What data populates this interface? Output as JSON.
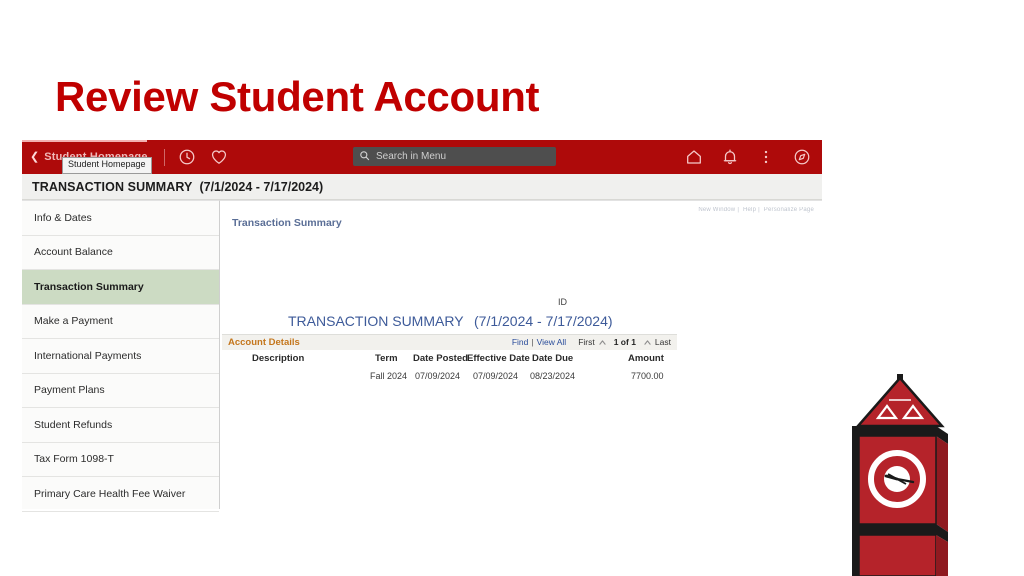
{
  "slide": {
    "title": "Review Student Account",
    "title_color": "#c00000"
  },
  "app": {
    "banner": {
      "back_icon": "chevron-left-icon",
      "breadcrumb": "Student Homepage",
      "tooltip": "Student Homepage",
      "history_icon": "clock-icon",
      "favorites_icon": "heart-icon",
      "home_icon": "home-icon",
      "notifications_icon": "bell-icon",
      "actions_icon": "kebab-menu-icon",
      "navigator_icon": "compass-icon",
      "accent_color": "#ae0a0a",
      "search": {
        "placeholder": "Search in Menu",
        "icon": "search-icon"
      }
    },
    "page_title": {
      "name": "TRANSACTION SUMMARY",
      "date_range": "(7/1/2024 - 7/17/2024)"
    },
    "sidebar": {
      "items": [
        {
          "label": "Info & Dates",
          "active": false
        },
        {
          "label": "Account Balance",
          "active": false
        },
        {
          "label": "Transaction Summary",
          "active": true
        },
        {
          "label": "Make a Payment",
          "active": false
        },
        {
          "label": "International Payments",
          "active": false
        },
        {
          "label": "Payment Plans",
          "active": false
        },
        {
          "label": "Student Refunds",
          "active": false
        },
        {
          "label": "Tax Form 1098-T",
          "active": false
        },
        {
          "label": "Primary Care Health Fee Waiver",
          "active": false
        }
      ],
      "active_color": "#ccdbc3"
    },
    "content": {
      "utility_links": [
        "New Window",
        "Help",
        "Personalize Page"
      ],
      "section_link": "Transaction Summary",
      "id_label": "ID",
      "summary_heading": "TRANSACTION SUMMARY",
      "summary_date_range": "(7/1/2024 - 7/17/2024)",
      "grid": {
        "title": "Account Details",
        "title_color": "#c4761c",
        "find_label": "Find",
        "view_all_label": "View All",
        "first_label": "First",
        "pager_label": "1 of 1",
        "last_label": "Last",
        "columns": [
          "Description",
          "Term",
          "Date Posted",
          "Effective Date",
          "Date Due",
          "Amount"
        ],
        "rows": [
          {
            "description": "",
            "term": "Fall 2024",
            "date_posted": "07/09/2024",
            "effective_date": "07/09/2024",
            "date_due": "08/23/2024",
            "amount": "7700.00"
          }
        ]
      }
    }
  },
  "decoration": {
    "clock_tower_icon": "clock-tower-illustration",
    "tower_red": "#b5232a",
    "tower_dark": "#1a1a1a"
  }
}
